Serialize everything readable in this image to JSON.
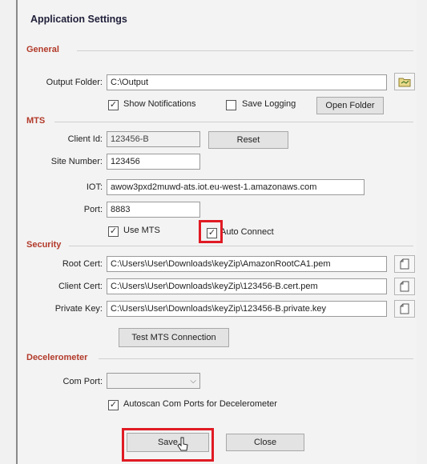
{
  "window": {
    "title": "Application Settings"
  },
  "general": {
    "section_label": "General",
    "output_folder_label": "Output Folder:",
    "output_folder_value": "C:\\Output",
    "show_notifications_label": "Show Notifications",
    "show_notifications_checked": true,
    "save_logging_label": "Save Logging",
    "save_logging_checked": false,
    "open_folder_label": "Open Folder"
  },
  "mts": {
    "section_label": "MTS",
    "client_id_label": "Client Id:",
    "client_id_value": "123456-B",
    "reset_label": "Reset",
    "site_number_label": "Site Number:",
    "site_number_value": "123456",
    "iot_label": "IOT:",
    "iot_value": "awow3pxd2muwd-ats.iot.eu-west-1.amazonaws.com",
    "port_label": "Port:",
    "port_value": "8883",
    "use_mts_label": "Use MTS",
    "use_mts_checked": true,
    "auto_connect_label": "Auto Connect",
    "auto_connect_checked": true
  },
  "security": {
    "section_label": "Security",
    "root_cert_label": "Root Cert:",
    "root_cert_value": "C:\\Users\\User\\Downloads\\keyZip\\AmazonRootCA1.pem",
    "client_cert_label": "Client Cert:",
    "client_cert_value": "C:\\Users\\User\\Downloads\\keyZip\\123456-B.cert.pem",
    "private_key_label": "Private Key:",
    "private_key_value": "C:\\Users\\User\\Downloads\\keyZip\\123456-B.private.key",
    "test_connection_label": "Test MTS Connection"
  },
  "decelerometer": {
    "section_label": "Decelerometer",
    "com_port_label": "Com Port:",
    "com_port_value": "",
    "autoscan_label": "Autoscan Com Ports for Decelerometer",
    "autoscan_checked": true
  },
  "footer": {
    "save_label": "Save",
    "close_label": "Close"
  },
  "colors": {
    "section_text": "#b23a2a",
    "highlight": "#e01b24",
    "window_bg": "#f3f3f3"
  }
}
